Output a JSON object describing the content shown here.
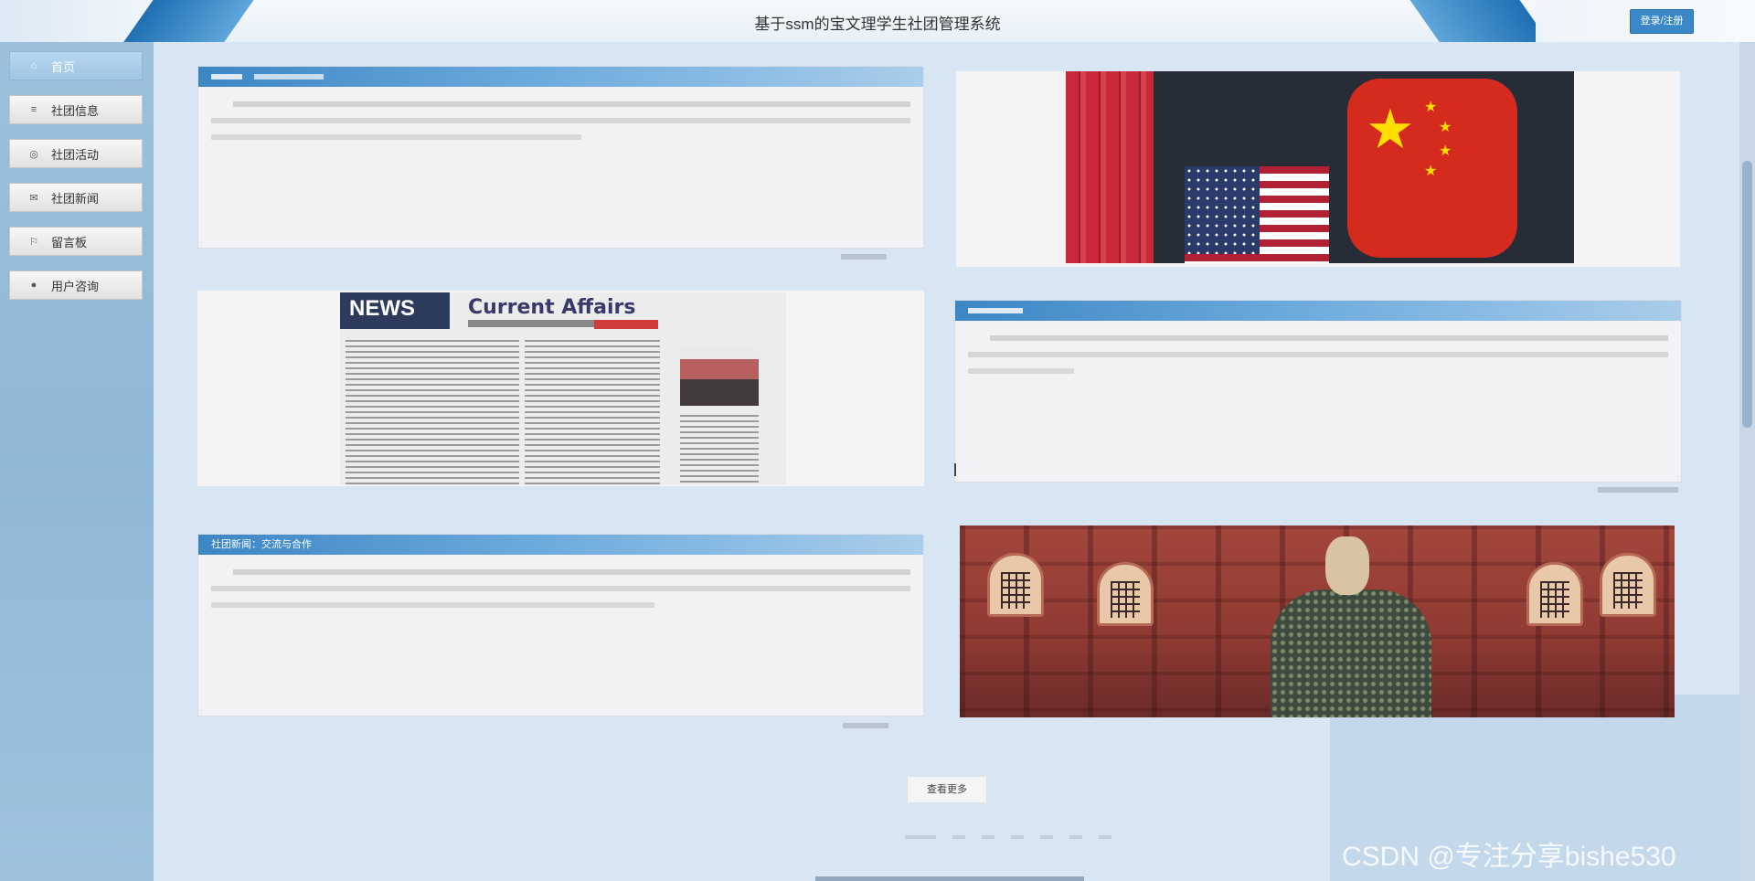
{
  "header": {
    "title": "基于ssm的宝文理学生社团管理系统",
    "login_label": "登录/注册"
  },
  "sidebar": {
    "items": [
      {
        "label": "首页",
        "icon": "home-icon",
        "glyph": "⌂"
      },
      {
        "label": "社团信息",
        "icon": "list-icon",
        "glyph": "≡"
      },
      {
        "label": "社团活动",
        "icon": "activity-icon",
        "glyph": "◎"
      },
      {
        "label": "社团新闻",
        "icon": "news-icon",
        "glyph": "✉"
      },
      {
        "label": "留言板",
        "icon": "flag-icon",
        "glyph": "⚐"
      },
      {
        "label": "用户咨询",
        "icon": "chat-icon",
        "glyph": "●"
      }
    ]
  },
  "content": {
    "panel3_title": "社团新闻：交流与合作",
    "paper_headline": "Current Affairs",
    "read_more_label": "查看更多"
  },
  "watermark": "CSDN @专注分享bishe530",
  "colors": {
    "accent": "#3a88c8",
    "panel_head": "#3c86c4",
    "sidebar": "#9cc0dc"
  }
}
